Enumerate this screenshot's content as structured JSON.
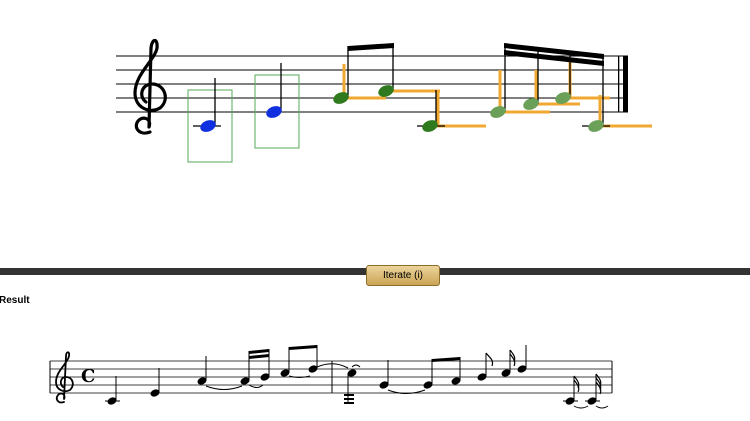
{
  "toolbar": {
    "iterate_label": "Iterate (i)"
  },
  "result": {
    "label": "Result"
  },
  "colors": {
    "selected_note": "#1030e0",
    "recognized_note": "#2f7a1e",
    "faded_note": "#6aa058",
    "guide_line": "#f0a830",
    "selection_box": "#5aa85a",
    "divider": "#333333"
  },
  "icons": {
    "editor_clef": "treble-clef-icon",
    "result_clef": "treble-clef-icon",
    "time_signature": "common-time-icon"
  },
  "time_signature_symbol": "C"
}
